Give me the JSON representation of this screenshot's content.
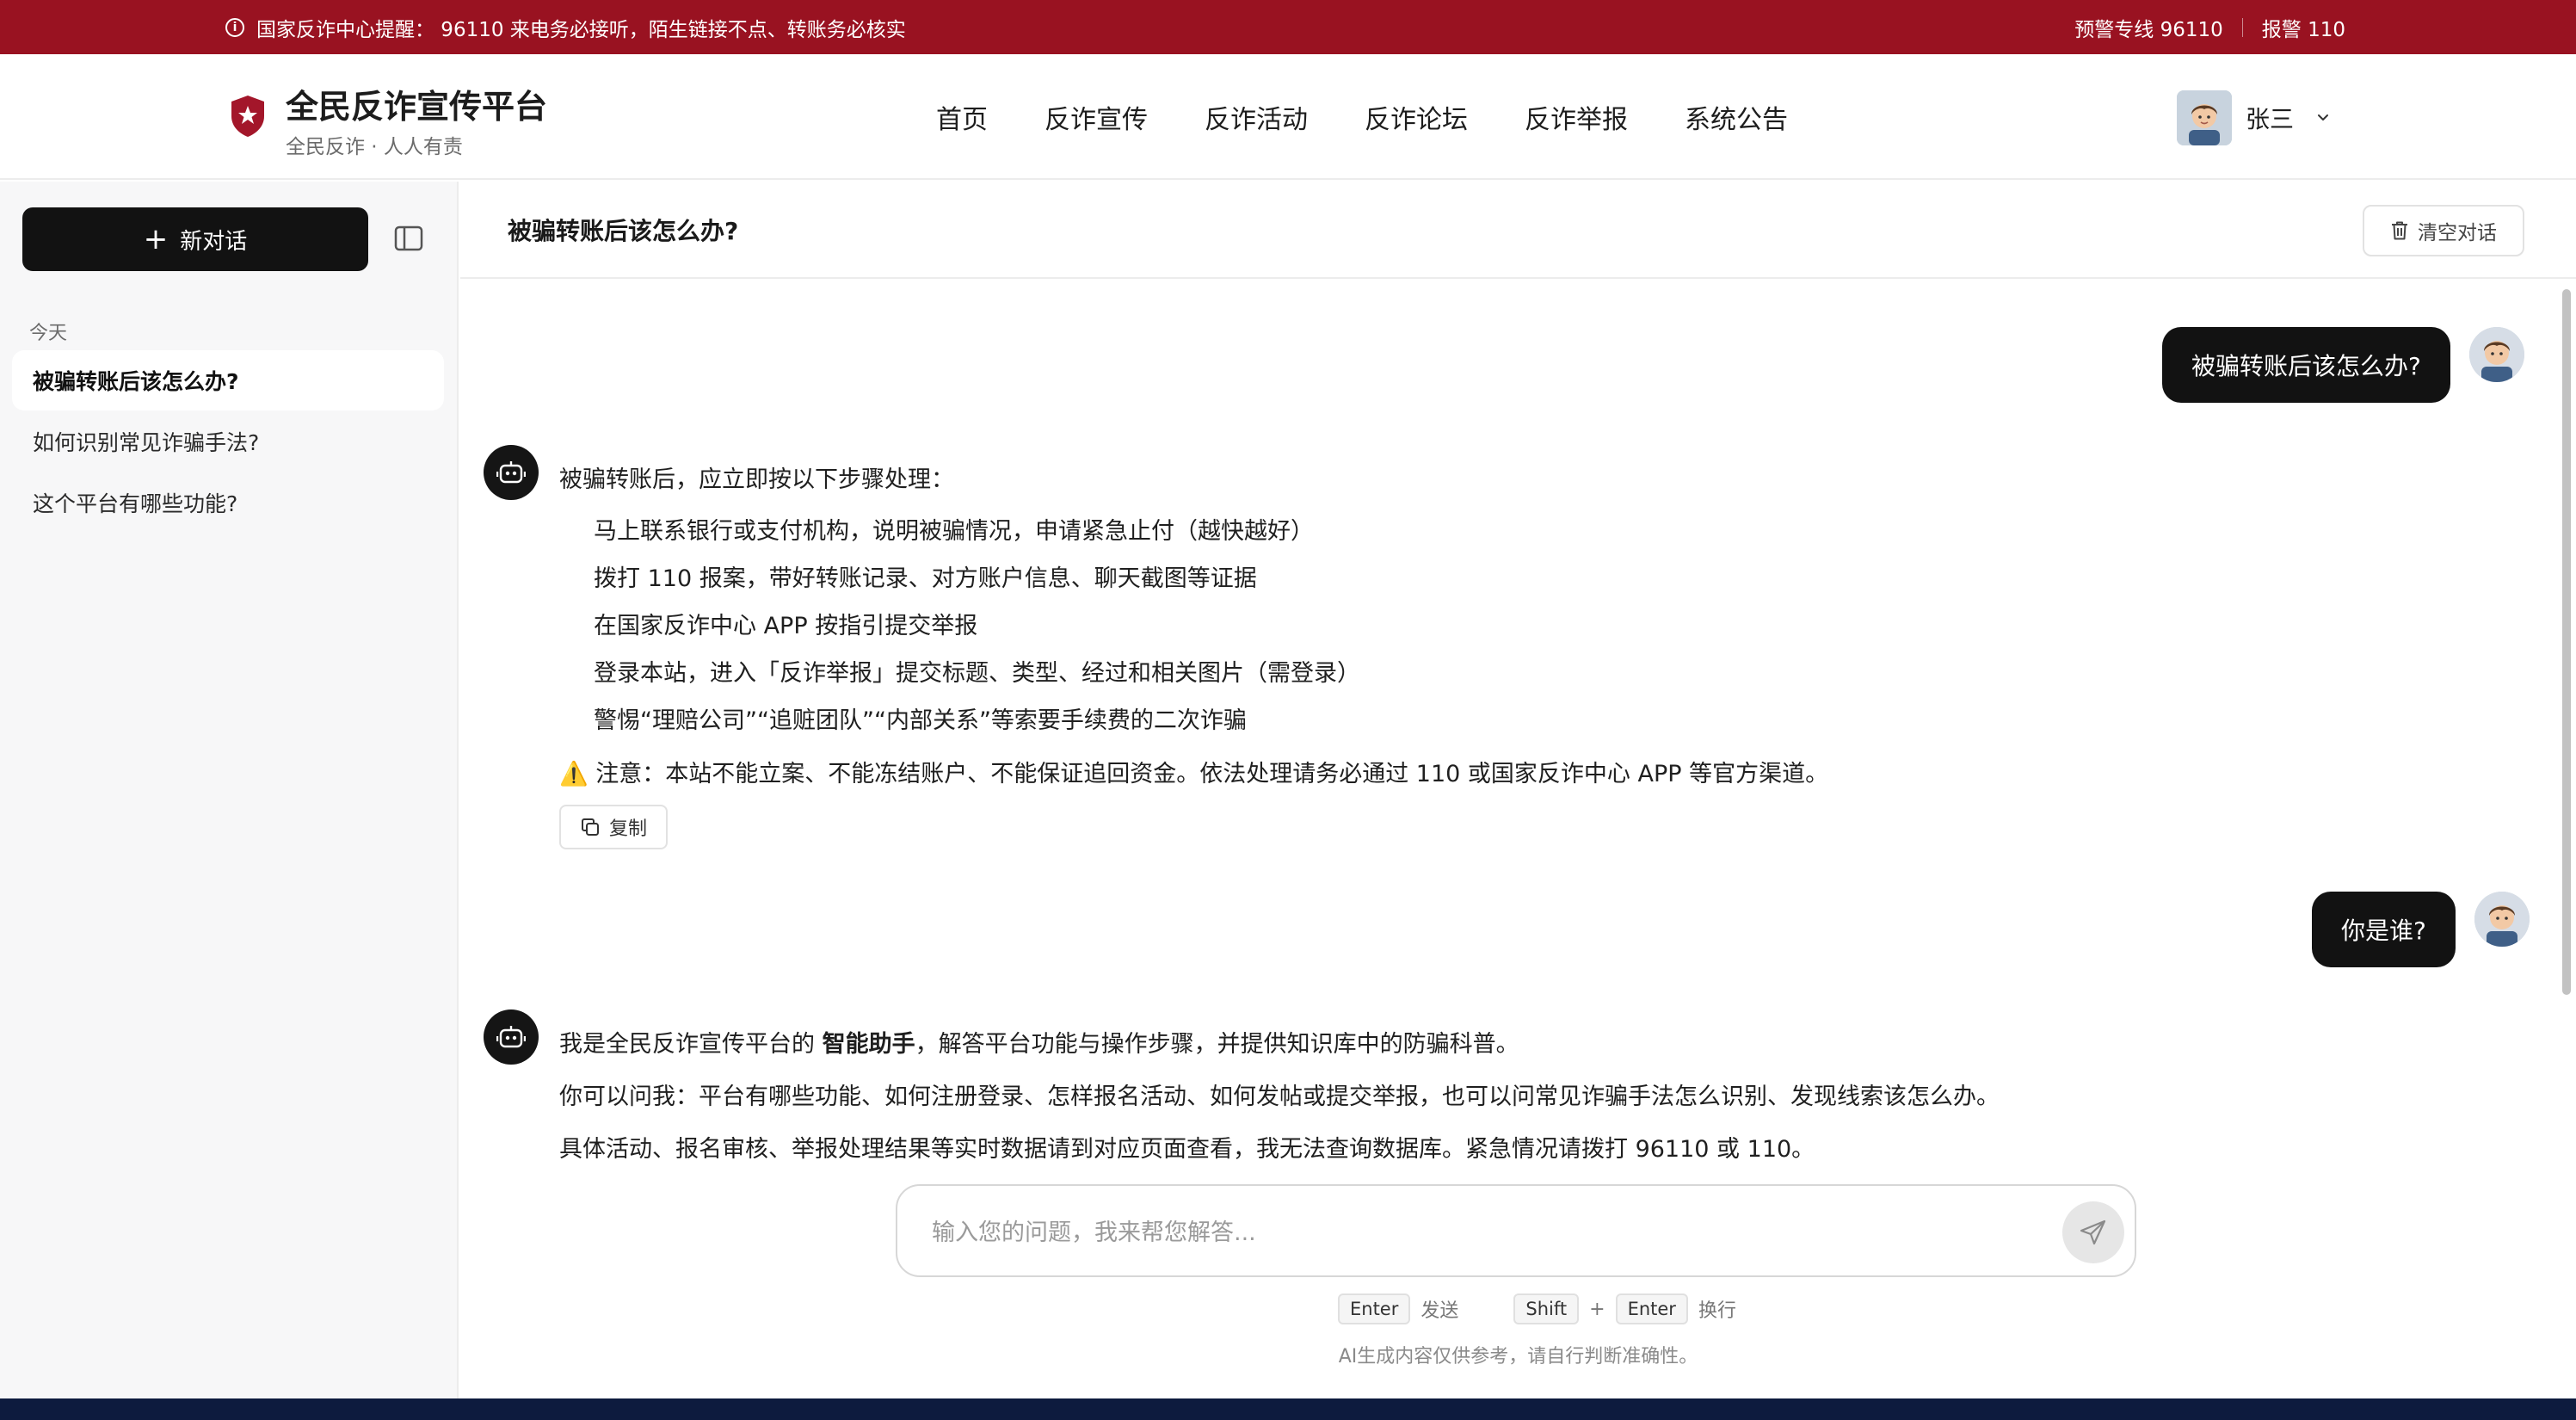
{
  "alert": {
    "message": "国家反诈中心提醒： 96110 来电务必接听，陌生链接不点、转账务必核实",
    "hotline": "预警专线 96110",
    "police": "报警 110"
  },
  "brand": {
    "title": "全民反诈宣传平台",
    "subtitle": "全民反诈 · 人人有责"
  },
  "nav": [
    "首页",
    "反诈宣传",
    "反诈活动",
    "反诈论坛",
    "反诈举报",
    "系统公告"
  ],
  "user": {
    "name": "张三"
  },
  "sidebar": {
    "new_chat_label": "新对话",
    "section_label": "今天",
    "history": [
      {
        "title": "被骗转账后该怎么办?",
        "active": true
      },
      {
        "title": "如何识别常见诈骗手法?",
        "active": false
      },
      {
        "title": "这个平台有哪些功能?",
        "active": false
      }
    ]
  },
  "chat": {
    "title": "被骗转账后该怎么办?",
    "clear_label": "清空对话",
    "messages": [
      {
        "role": "user",
        "text": "被骗转账后该怎么办?"
      },
      {
        "role": "assistant",
        "intro": "被骗转账后，应立即按以下步骤处理：",
        "steps": [
          "马上联系银行或支付机构，说明被骗情况，申请紧急止付（越快越好）",
          "拨打 110 报案，带好转账记录、对方账户信息、聊天截图等证据",
          "在国家反诈中心 APP 按指引提交举报",
          "登录本站，进入「反诈举报」提交标题、类型、经过和相关图片（需登录）",
          "警惕“理赔公司”“追赃团队”“内部关系”等索要手续费的二次诈骗"
        ],
        "warning_emoji": "⚠️",
        "warning": "注意：本站不能立案、不能冻结账户、不能保证追回资金。依法处理请务必通过 110 或国家反诈中心 APP 等官方渠道。",
        "copy_label": "复制"
      },
      {
        "role": "user",
        "text": "你是谁?"
      },
      {
        "role": "assistant",
        "line1_pre": "我是全民反诈宣传平台的 ",
        "line1_bold": "智能助手",
        "line1_post": "，解答平台功能与操作步骤，并提供知识库中的防骗科普。",
        "line2": "你可以问我：平台有哪些功能、如何注册登录、怎样报名活动、如何发帖或提交举报，也可以问常见诈骗手法怎么识别、发现线索该怎么办。",
        "line3": "具体活动、报名审核、举报处理结果等实时数据请到对应页面查看，我无法查询数据库。紧急情况请拨打 96110 或 110。"
      }
    ]
  },
  "composer": {
    "placeholder": "输入您的问题，我来帮您解答...",
    "hint_enter_key": "Enter",
    "hint_enter_action": "发送",
    "hint_shift_key": "Shift",
    "hint_plus": "+",
    "hint_enter_key2": "Enter",
    "hint_newline_action": "换行",
    "disclaimer": "AI生成内容仅供参考，请自行判断准确性。"
  },
  "colors": {
    "alert_bg": "#991221",
    "brand_shield": "#a3162a",
    "primary_dark": "#121212",
    "bottom_bar": "#0d1b3e"
  },
  "icons": {
    "info": "info-circle-icon",
    "shield": "shield-star-icon",
    "plus": "plus-icon",
    "sidebar_toggle": "sidebar-panel-icon",
    "trash": "trash-icon",
    "robot": "robot-icon",
    "copy": "copy-icon",
    "send": "send-icon",
    "chevron": "chevron-down-icon"
  }
}
